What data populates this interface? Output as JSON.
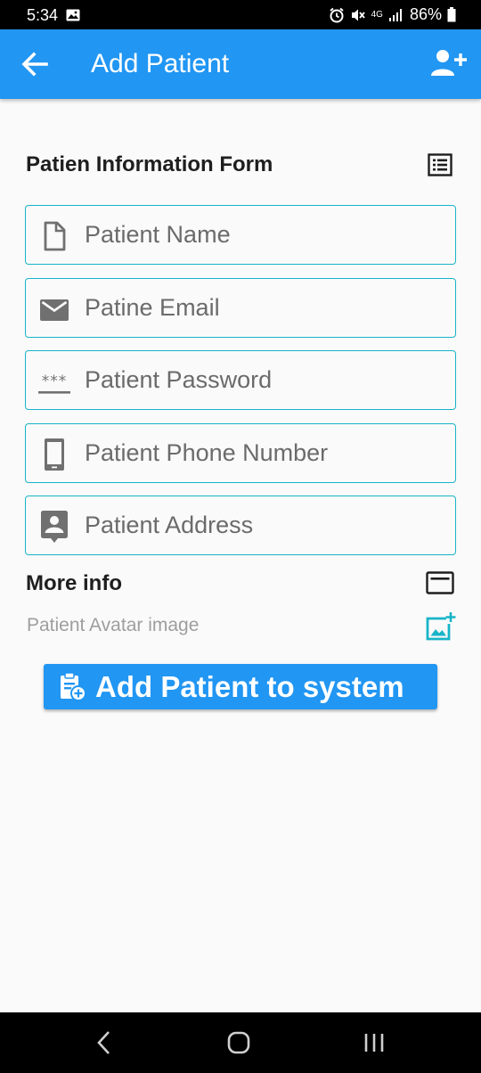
{
  "status_bar": {
    "time": "5:34",
    "battery": "86%",
    "network": "4G",
    "icons": [
      "gallery-icon",
      "alarm-icon",
      "mute-icon",
      "signal-icon",
      "battery-icon"
    ]
  },
  "app_bar": {
    "title": "Add Patient",
    "color": "#2196f3",
    "icons": [
      "back-arrow-icon",
      "add-person-icon"
    ]
  },
  "form": {
    "title": "Patien Information Form",
    "title_icon": "list-icon",
    "border_color": "#18b4c8",
    "fields": [
      {
        "placeholder": "Patient Name",
        "icon": "document-icon"
      },
      {
        "placeholder": "Patine Email",
        "icon": "email-icon"
      },
      {
        "placeholder": "Patient Password",
        "icon": "password-icon"
      },
      {
        "placeholder": "Patient Phone Number",
        "icon": "phone-icon"
      },
      {
        "placeholder": "Patient Address",
        "icon": "contact-icon"
      }
    ]
  },
  "more_info": {
    "title": "More info",
    "title_icon": "card-icon",
    "avatar_label": "Patient Avatar image",
    "avatar_icon": "add-photo-icon"
  },
  "submit": {
    "label": "Add Patient to system",
    "icon": "clipboard-add-icon"
  },
  "nav_bar": {
    "icons": [
      "nav-back-icon",
      "nav-home-icon",
      "nav-recents-icon"
    ]
  }
}
